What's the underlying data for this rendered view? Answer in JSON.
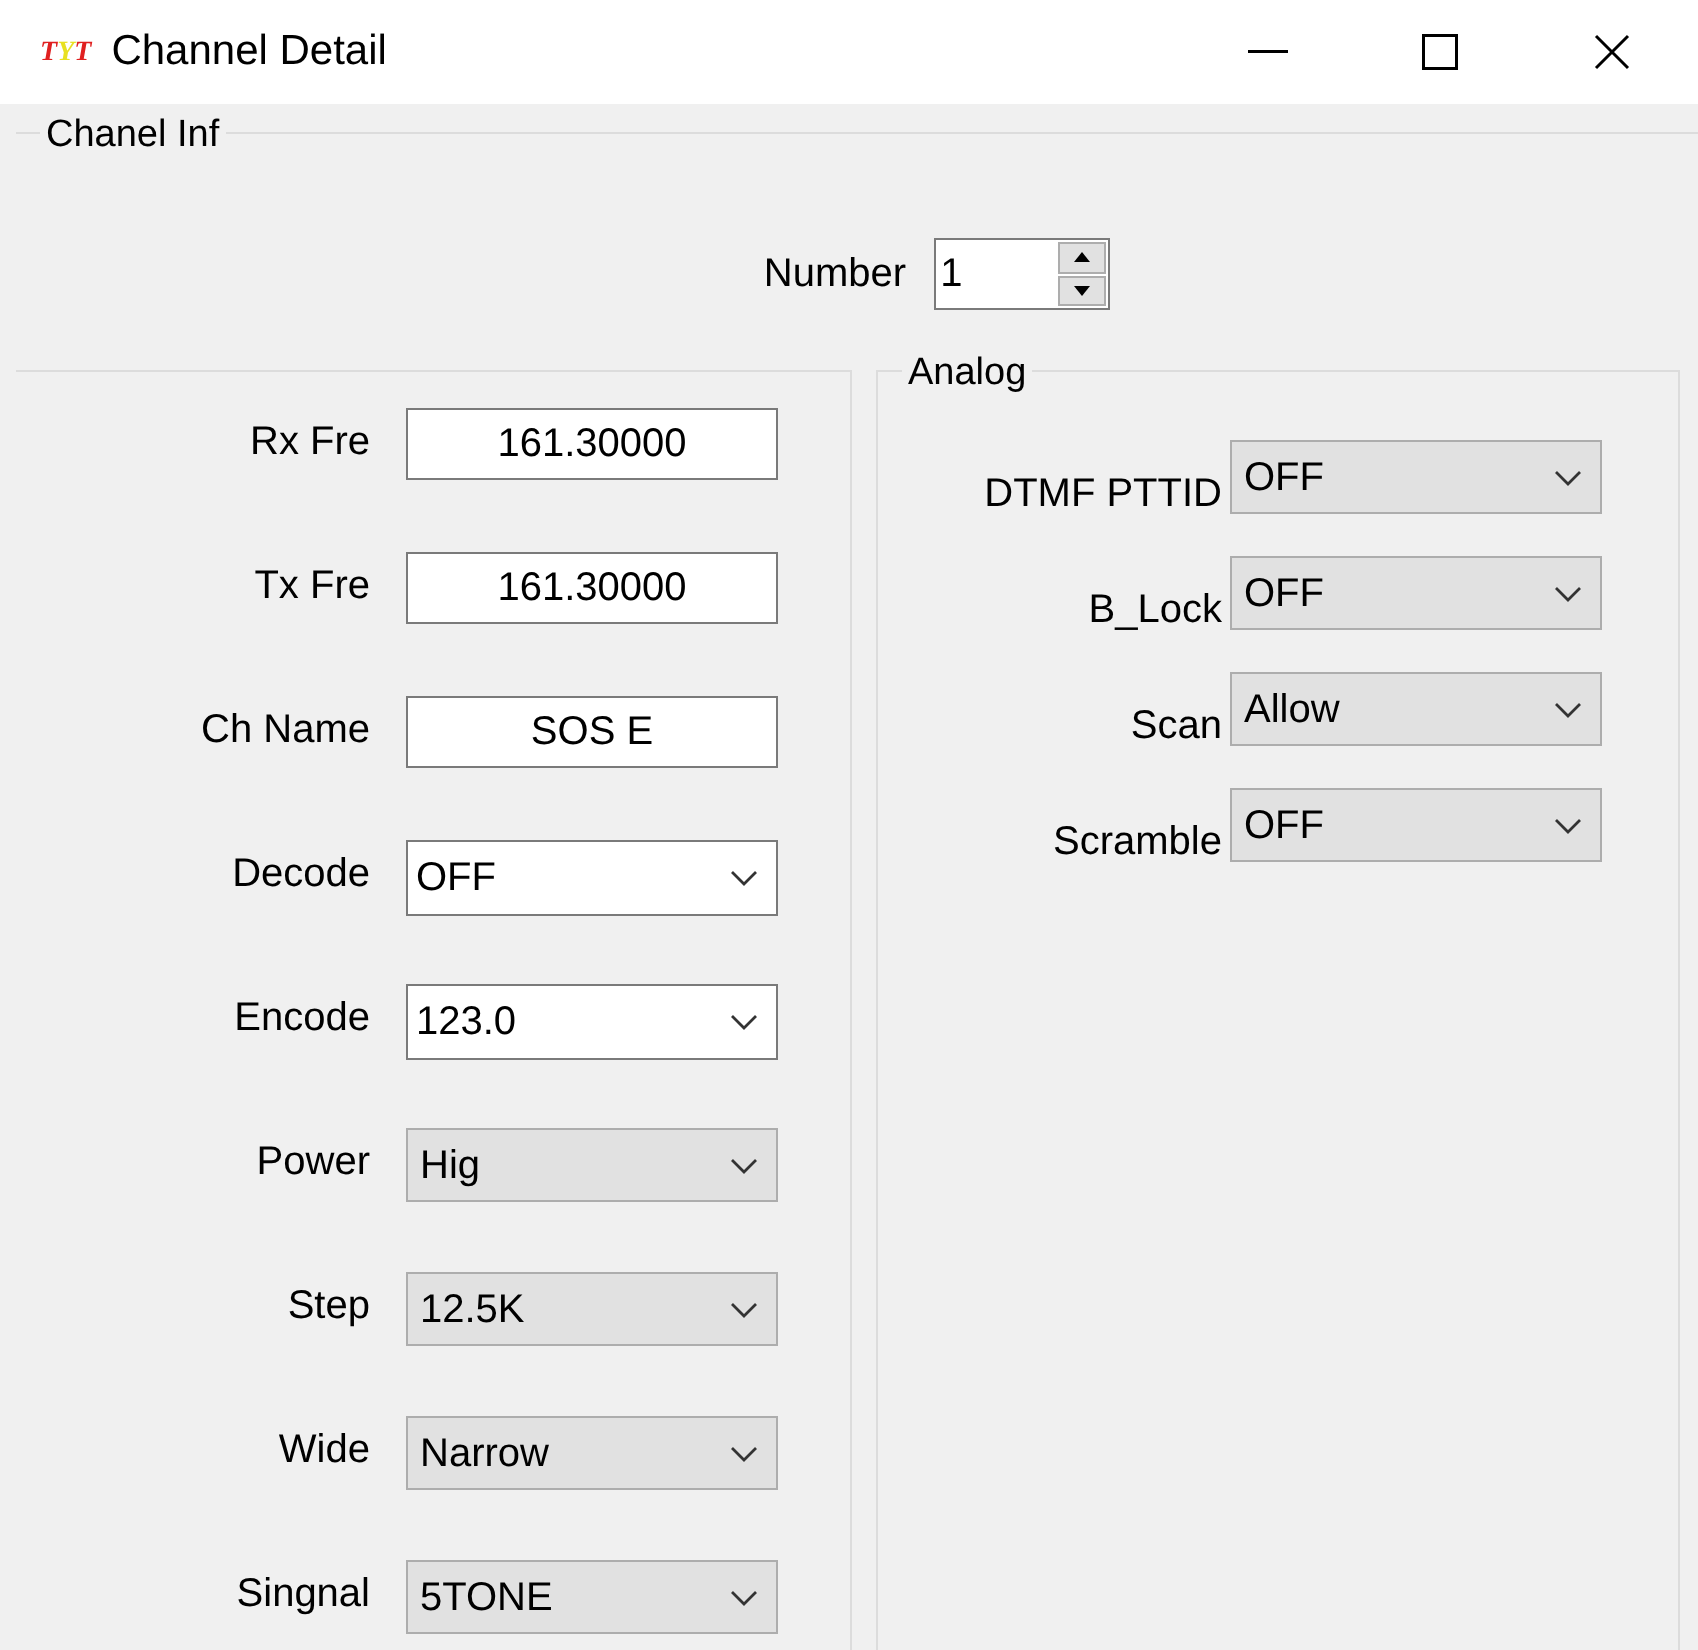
{
  "window": {
    "logo": "TYT",
    "title": "Channel Detail"
  },
  "group": {
    "title": "Chanel Inf",
    "number": {
      "label": "Number",
      "value": "1"
    }
  },
  "left_fields": [
    {
      "label": "Rx Fre",
      "kind": "text",
      "value": "161.30000"
    },
    {
      "label": "Tx Fre",
      "kind": "text",
      "value": "161.30000"
    },
    {
      "label": "Ch Name",
      "kind": "text",
      "value": "SOS E"
    },
    {
      "label": "Decode",
      "kind": "combo",
      "value": "OFF"
    },
    {
      "label": "Encode",
      "kind": "combo",
      "value": "123.0"
    },
    {
      "label": "Power",
      "kind": "dropdown",
      "value": "Hig"
    },
    {
      "label": "Step",
      "kind": "dropdown",
      "value": "12.5K"
    },
    {
      "label": "Wide",
      "kind": "dropdown",
      "value": "Narrow"
    },
    {
      "label": "Singnal",
      "kind": "dropdown",
      "value": "5TONE"
    }
  ],
  "analog": {
    "title": "Analog",
    "fields": [
      {
        "label": "DTMF PTTID",
        "kind": "dropdown",
        "value": "OFF"
      },
      {
        "label": "B_Lock",
        "kind": "dropdown",
        "value": "OFF"
      },
      {
        "label": "Scan",
        "kind": "dropdown",
        "value": "Allow"
      },
      {
        "label": "Scramble",
        "kind": "dropdown",
        "value": "OFF"
      }
    ]
  }
}
